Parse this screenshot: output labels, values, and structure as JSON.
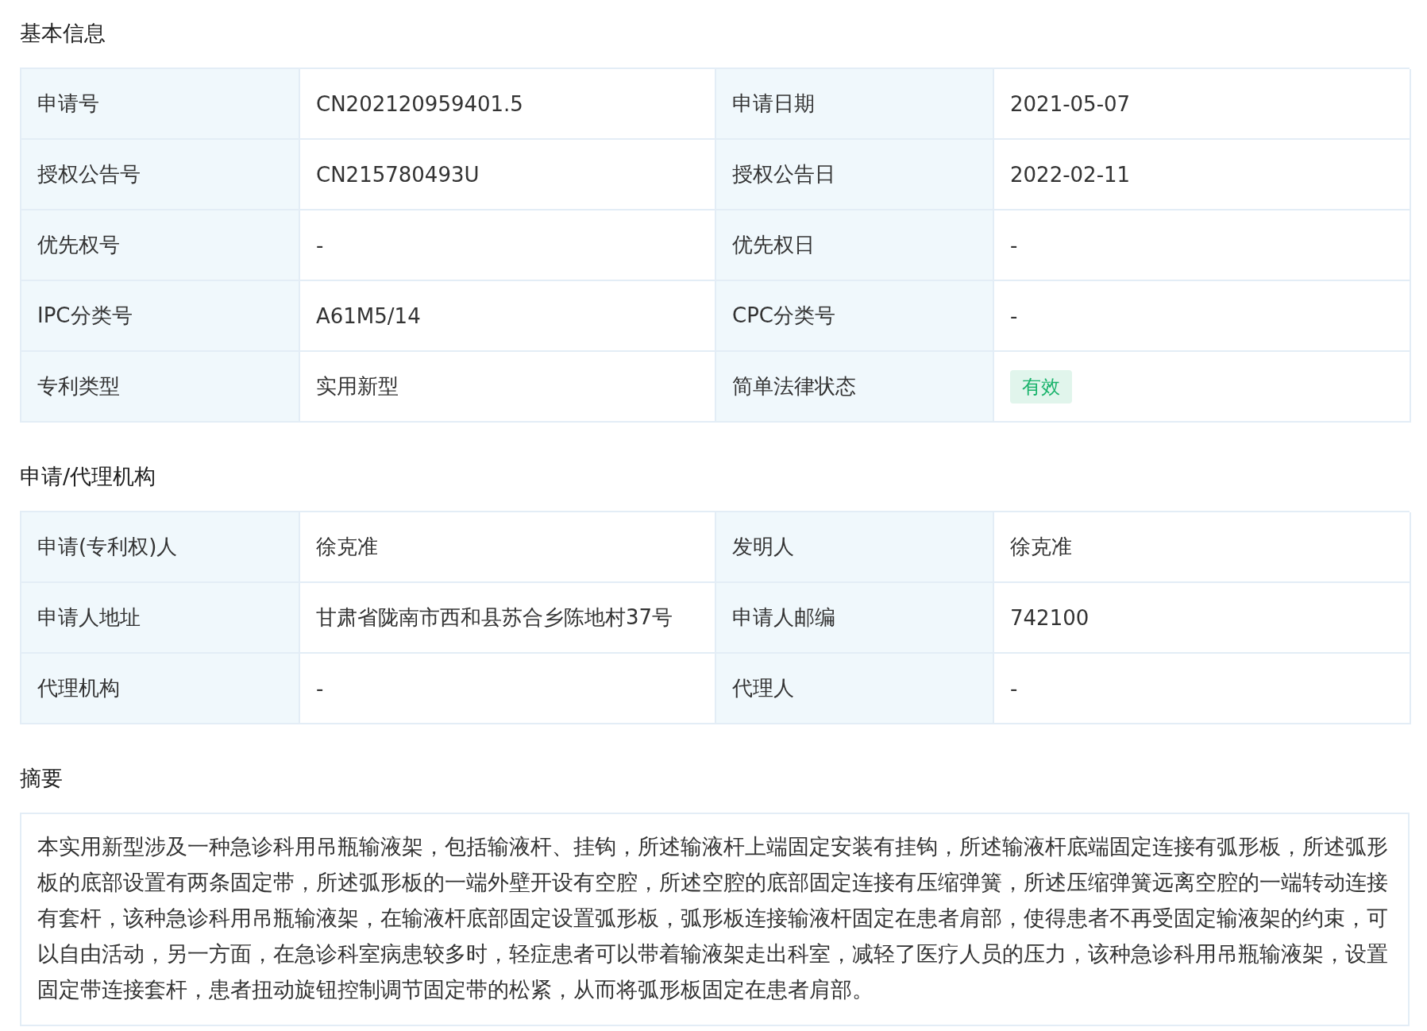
{
  "sections": [
    {
      "kind": "table",
      "title": "基本信息",
      "rows": [
        [
          {
            "label": "申请号",
            "value": "CN202120959401.5",
            "kind": "text"
          },
          {
            "label": "申请日期",
            "value": "2021-05-07",
            "kind": "text"
          }
        ],
        [
          {
            "label": "授权公告号",
            "value": "CN215780493U",
            "kind": "text"
          },
          {
            "label": "授权公告日",
            "value": "2022-02-11",
            "kind": "text"
          }
        ],
        [
          {
            "label": "优先权号",
            "value": "-",
            "kind": "text"
          },
          {
            "label": "优先权日",
            "value": "-",
            "kind": "text"
          }
        ],
        [
          {
            "label": "IPC分类号",
            "value": "A61M5/14",
            "kind": "text"
          },
          {
            "label": "CPC分类号",
            "value": "-",
            "kind": "text"
          }
        ],
        [
          {
            "label": "专利类型",
            "value": "实用新型",
            "kind": "text"
          },
          {
            "label": "简单法律状态",
            "value": "有效",
            "kind": "badge",
            "color": "#19b36b"
          }
        ]
      ]
    },
    {
      "kind": "table",
      "title": "申请/代理机构",
      "rows": [
        [
          {
            "label": "申请(专利权)人",
            "value": "徐克准",
            "kind": "text"
          },
          {
            "label": "发明人",
            "value": "徐克准",
            "kind": "text"
          }
        ],
        [
          {
            "label": "申请人地址",
            "value": "甘肃省陇南市西和县苏合乡陈地村37号",
            "kind": "text"
          },
          {
            "label": "申请人邮编",
            "value": "742100",
            "kind": "text"
          }
        ],
        [
          {
            "label": "代理机构",
            "value": "-",
            "kind": "text"
          },
          {
            "label": "代理人",
            "value": "-",
            "kind": "text"
          }
        ]
      ]
    },
    {
      "kind": "text",
      "title": "摘要",
      "text": "本实用新型涉及一种急诊科用吊瓶输液架，包括输液杆、挂钩，所述输液杆上端固定安装有挂钩，所述输液杆底端固定连接有弧形板，所述弧形板的底部设置有两条固定带，所述弧形板的一端外壁开设有空腔，所述空腔的底部固定连接有压缩弹簧，所述压缩弹簧远离空腔的一端转动连接有套杆，该种急诊科用吊瓶输液架，在输液杆底部固定设置弧形板，弧形板连接输液杆固定在患者肩部，使得患者不再受固定输液架的约束，可以自由活动，另一方面，在急诊科室病患较多时，轻症患者可以带着输液架走出科室，减轻了医疗人员的压力，该种急诊科用吊瓶输液架，设置固定带连接套杆，患者扭动旋钮控制调节固定带的松紧，从而将弧形板固定在患者肩部。"
    }
  ]
}
